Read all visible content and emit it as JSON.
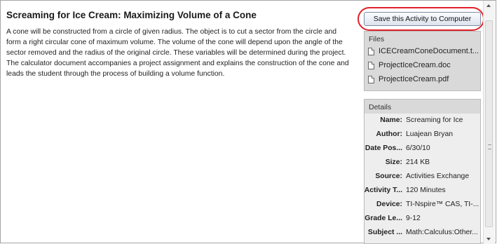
{
  "activity": {
    "title": "Screaming for Ice Cream: Maximizing Volume of a Cone",
    "description": "A cone will be constructed from a circle of given radius. The object is to cut a sector from the circle and form a right circular cone of maximum volume. The volume of the cone will depend upon the angle of the sector removed and the radius of the original circle. These variables will be determined during the project. The calculator document accompanies a project assignment and explains the construction of the cone and leads the student through the process of building a volume function."
  },
  "actions": {
    "save_label": "Save this Activity to Computer"
  },
  "files": {
    "header": "Files",
    "items": [
      {
        "name": "ICECreamConeDocument.t..."
      },
      {
        "name": "ProjectIceCream.doc"
      },
      {
        "name": "ProjectIceCream.pdf"
      }
    ]
  },
  "details": {
    "header": "Details",
    "rows": [
      {
        "key": "Name:",
        "value": "Screaming for Ice"
      },
      {
        "key": "Author:",
        "value": "Luajean Bryan"
      },
      {
        "key": "Date Pos...",
        "value": "6/30/10"
      },
      {
        "key": "Size:",
        "value": "214 KB"
      },
      {
        "key": "Source:",
        "value": "Activities Exchange"
      },
      {
        "key": "Activity T...",
        "value": "120 Minutes"
      },
      {
        "key": "Device:",
        "value": "TI-Nspire™ CAS, TI-..."
      },
      {
        "key": "Grade Le...",
        "value": "9-12"
      },
      {
        "key": "Subject ...",
        "value": "Math:Calculus:Other..."
      }
    ]
  },
  "colors": {
    "highlight_oval": "#e0202a",
    "panel_bg": "#d9d9d9"
  }
}
